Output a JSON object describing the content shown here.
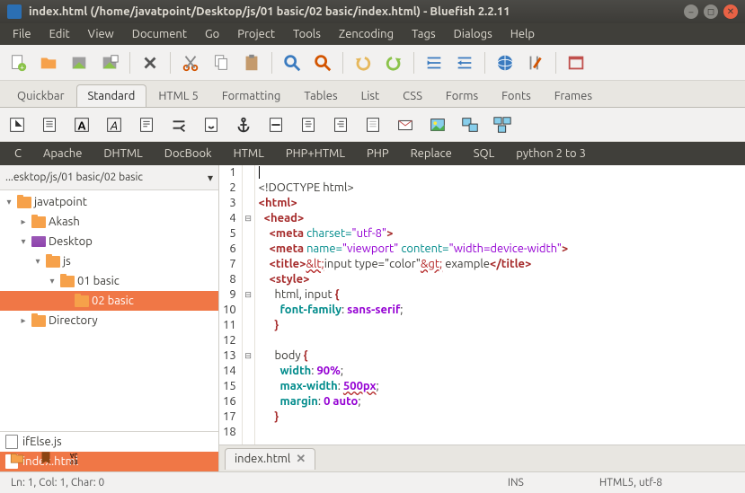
{
  "window": {
    "title": "index.html (/home/javatpoint/Desktop/js/01 basic/02 basic/index.html) - Bluefish 2.2.11"
  },
  "menubar": [
    "File",
    "Edit",
    "View",
    "Document",
    "Go",
    "Project",
    "Tools",
    "Zencoding",
    "Tags",
    "Dialogs",
    "Help"
  ],
  "toolbar_tabs": [
    "Quickbar",
    "Standard",
    "HTML 5",
    "Formatting",
    "Tables",
    "List",
    "CSS",
    "Forms",
    "Fonts",
    "Frames"
  ],
  "toolbar_tabs_active": "Standard",
  "langbar": [
    "C",
    "Apache",
    "DHTML",
    "DocBook",
    "HTML",
    "PHP+HTML",
    "PHP",
    "Replace",
    "SQL",
    "python 2 to 3"
  ],
  "sidebar": {
    "path": "...esktop/js/01 basic/02 basic",
    "tree": [
      {
        "indent": 0,
        "label": "javatpoint",
        "expander": "▾",
        "icon": "folder",
        "sel": false
      },
      {
        "indent": 1,
        "label": "Akash",
        "expander": "▸",
        "icon": "folder",
        "sel": false
      },
      {
        "indent": 1,
        "label": "Desktop",
        "expander": "▾",
        "icon": "desktop",
        "sel": false
      },
      {
        "indent": 2,
        "label": "js",
        "expander": "▾",
        "icon": "folder",
        "sel": false
      },
      {
        "indent": 3,
        "label": "01 basic",
        "expander": "▾",
        "icon": "folder",
        "sel": false
      },
      {
        "indent": 4,
        "label": "02 basic",
        "expander": "",
        "icon": "folder",
        "sel": true
      },
      {
        "indent": 1,
        "label": "Directory",
        "expander": "▸",
        "icon": "folder",
        "sel": false
      }
    ],
    "files": [
      {
        "name": "ifElse.js",
        "sel": false
      },
      {
        "name": "index.html",
        "sel": true
      }
    ]
  },
  "editor": {
    "lines": [
      {
        "n": 1,
        "fold": "",
        "html": "<span class='cursor-line'></span>"
      },
      {
        "n": 2,
        "fold": "",
        "html": "&lt;!DOCTYPE html&gt;"
      },
      {
        "n": 3,
        "fold": "",
        "html": "<span class='k-tag'>&lt;html&gt;</span>"
      },
      {
        "n": 4,
        "fold": "⊟",
        "html": "  <span class='k-tag'>&lt;head&gt;</span>"
      },
      {
        "n": 5,
        "fold": "",
        "html": "    <span class='k-tag'>&lt;meta</span> <span class='k-attr'>charset=</span><span class='k-str'>\"utf-8\"</span><span class='k-tag'>&gt;</span>"
      },
      {
        "n": 6,
        "fold": "",
        "html": "    <span class='k-tag'>&lt;meta</span> <span class='k-attr'>name=</span><span class='k-str'>\"viewport\"</span> <span class='k-attr'>content=</span><span class='k-str'>\"width=device-width\"</span><span class='k-tag'>&gt;</span>"
      },
      {
        "n": 7,
        "fold": "",
        "html": "    <span class='k-tag'>&lt;title&gt;</span><span class='k-ent'>&amp;lt;</span>input type=\"color\"<span class='k-ent'>&amp;gt;</span> example<span class='k-tag'>&lt;/title&gt;</span>"
      },
      {
        "n": 8,
        "fold": "",
        "html": "    <span class='k-tag'>&lt;style&gt;</span>"
      },
      {
        "n": 9,
        "fold": "⊟",
        "html": "      html, input <span class='k-tag'>{</span>"
      },
      {
        "n": 10,
        "fold": "",
        "html": "        <span class='k-prop'>font-family</span>: <span class='k-val'>sans-serif</span>;"
      },
      {
        "n": 11,
        "fold": "",
        "html": "      <span class='k-tag'>}</span>"
      },
      {
        "n": 12,
        "fold": "",
        "html": ""
      },
      {
        "n": 13,
        "fold": "⊟",
        "html": "      body <span class='k-tag'>{</span>"
      },
      {
        "n": 14,
        "fold": "",
        "html": "        <span class='k-prop'>width</span>: <span class='k-num'>90%</span>;"
      },
      {
        "n": 15,
        "fold": "",
        "html": "        <span class='k-prop'>max-width</span>: <span class='k-valu'>500px</span>;"
      },
      {
        "n": 16,
        "fold": "",
        "html": "        <span class='k-prop'>margin</span>: <span class='k-num'>0</span> <span class='k-val'>auto</span>;"
      },
      {
        "n": 17,
        "fold": "",
        "html": "      <span class='k-tag'>}</span>"
      },
      {
        "n": 18,
        "fold": "",
        "html": ""
      }
    ]
  },
  "doc_tab": {
    "label": "index.html"
  },
  "status": {
    "pos": "Ln: 1, Col: 1, Char: 0",
    "ins": "INS",
    "mode": "HTML5, utf-8"
  }
}
